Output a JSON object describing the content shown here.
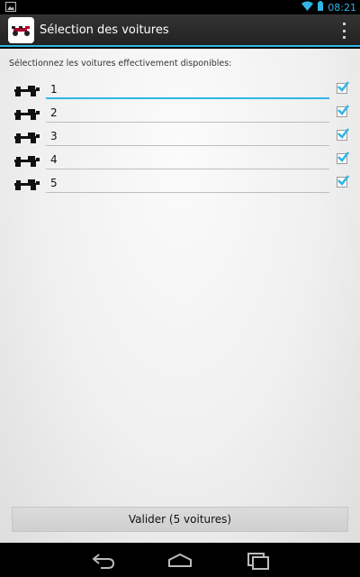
{
  "status_bar": {
    "time": "08:21",
    "icons": [
      "image-notification-icon",
      "wifi-icon",
      "battery-icon"
    ]
  },
  "action_bar": {
    "title": "Sélection des voitures",
    "app_icon": "race-car-icon",
    "overflow_icon": "overflow-menu-icon"
  },
  "main": {
    "instruction": "Sélectionnez les voitures effectivement disponibles:",
    "cars": [
      {
        "name": "1",
        "checked": true,
        "focused": true
      },
      {
        "name": "2",
        "checked": true,
        "focused": false
      },
      {
        "name": "3",
        "checked": true,
        "focused": false
      },
      {
        "name": "4",
        "checked": true,
        "focused": false
      },
      {
        "name": "5",
        "checked": true,
        "focused": false
      }
    ],
    "validate_label": "Valider (5 voitures)"
  },
  "nav_bar": {
    "icons": [
      "back-icon",
      "home-icon",
      "recent-apps-icon"
    ]
  },
  "colors": {
    "accent": "#33b5e5",
    "checkbox_check": "#33b5e5"
  }
}
